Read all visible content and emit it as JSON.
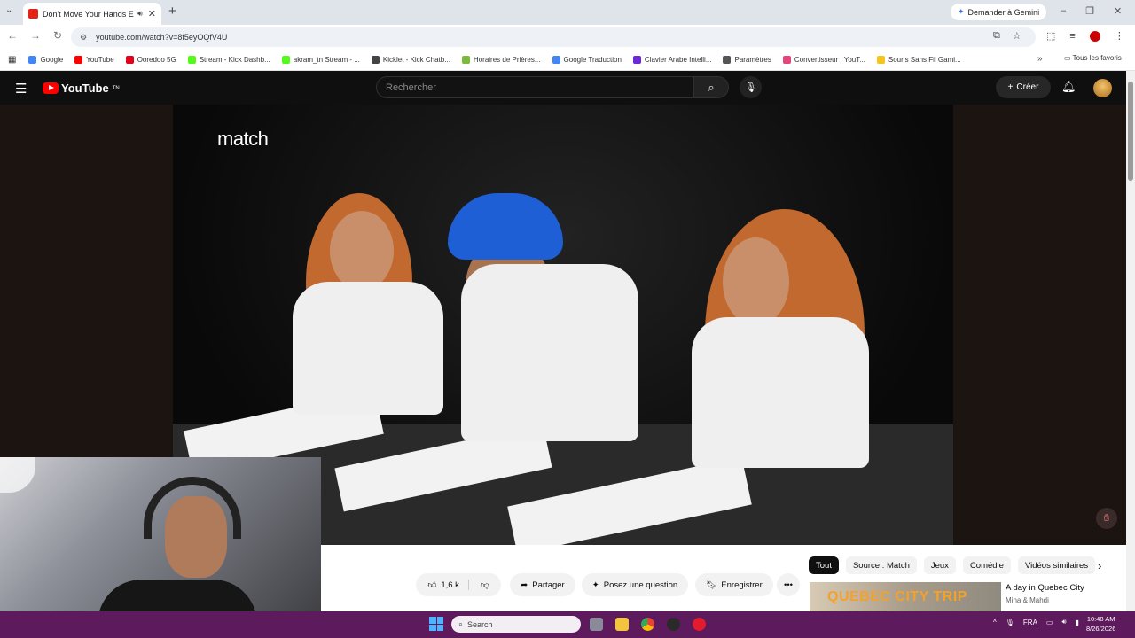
{
  "browser": {
    "tab_title": "Don't Move Your Hands Ep",
    "gemini_label": "Demander à Gemini",
    "url": "youtube.com/watch?v=8f5eyOQfV4U",
    "bookmarks": [
      {
        "label": "Google",
        "color": "#4285f4"
      },
      {
        "label": "YouTube",
        "color": "#ff0000"
      },
      {
        "label": "Ooredoo 5G",
        "color": "#e2001a"
      },
      {
        "label": "Stream - Kick Dashb...",
        "color": "#53fc18"
      },
      {
        "label": "akram_tn Stream - ...",
        "color": "#53fc18"
      },
      {
        "label": "Kicklet - Kick Chatb...",
        "color": "#444444"
      },
      {
        "label": "Horaires de Prières...",
        "color": "#7dba3c"
      },
      {
        "label": "Google Traduction",
        "color": "#4285f4"
      },
      {
        "label": "Clavier Arabe Intelli...",
        "color": "#6d28d9"
      },
      {
        "label": "Paramètres",
        "color": "#555555"
      },
      {
        "label": "Convertisseur : YouT...",
        "color": "#e6457a"
      },
      {
        "label": "Souris Sans Fil Gami...",
        "color": "#f5c518"
      }
    ],
    "all_favorites": "Tous les favoris"
  },
  "youtube": {
    "logo_text": "YouTube",
    "logo_sup": "TN",
    "search_placeholder": "Rechercher",
    "create_label": "Créer",
    "video_watermark": "match",
    "actions": {
      "likes": "1,6 k",
      "share": "Partager",
      "ask": "Posez une question",
      "save": "Enregistrer"
    },
    "chips": [
      "Tout",
      "Source : Match",
      "Jeux",
      "Comédie",
      "Vidéos similaires"
    ],
    "recommendation": {
      "thumb_text": "QUEBEC CITY TRIP",
      "title": "A day in Quebec City",
      "channel": "Mina & Mahdi"
    }
  },
  "taskbar": {
    "search_label": "Search",
    "language": "FRA",
    "time": "10:48 AM",
    "date": "8/26/2026"
  }
}
